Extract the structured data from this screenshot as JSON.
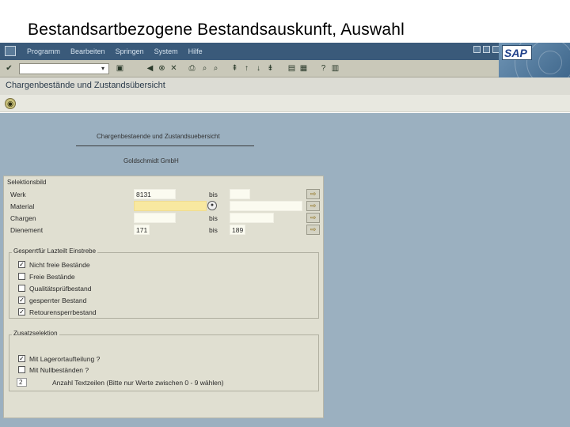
{
  "slide_title": "Bestandsartbezogene Bestandsauskunft, Auswahl",
  "menubar": {
    "items": [
      "Programm",
      "Bearbeiten",
      "Springen",
      "System",
      "Hilfe"
    ]
  },
  "logo": "SAP",
  "screen_title": "Chargenbestände und Zustandsübersicht",
  "report_header": {
    "line1": "Chargenbestaende und Zustandsuebersicht",
    "line2": "Goldschmidt GmbH"
  },
  "selection": {
    "title": "Selektionsbild",
    "to_label": "bis",
    "rows": [
      {
        "label": "Werk",
        "from": "8131",
        "to": ""
      },
      {
        "label": "Material",
        "from": "",
        "to": ""
      },
      {
        "label": "Chargen",
        "from": "",
        "to": ""
      },
      {
        "label": "Dienement",
        "from": "171",
        "to": "189"
      }
    ]
  },
  "group1": {
    "title": "Gesperrtfür Lazteilt Einstrebe",
    "options": [
      {
        "label": "Nicht freie Bestände",
        "checked": true
      },
      {
        "label": "Freie Bestände",
        "checked": false
      },
      {
        "label": "Qualitätsprüfbestand",
        "checked": false
      },
      {
        "label": "gesperrter Bestand",
        "checked": true
      },
      {
        "label": "Retourensperrbestand",
        "checked": true
      }
    ]
  },
  "group2": {
    "title": "Zusatzselektion",
    "options": [
      {
        "label": "Mit Lagerortaufteilung ?",
        "checked": true
      },
      {
        "label": "Mit Nullbeständen ?",
        "checked": false
      }
    ],
    "lines_value": "2",
    "lines_label": "Anzahl Textzeilen (Bitte nur Werte zwischen 0 - 9 wählen)"
  },
  "colors": {
    "menubar": "#3a5a7a",
    "toolbar": "#c9c8b9",
    "workspace": "#9bb0c0",
    "panel": "#e0dfd1",
    "required_field": "#f8e8a0"
  }
}
